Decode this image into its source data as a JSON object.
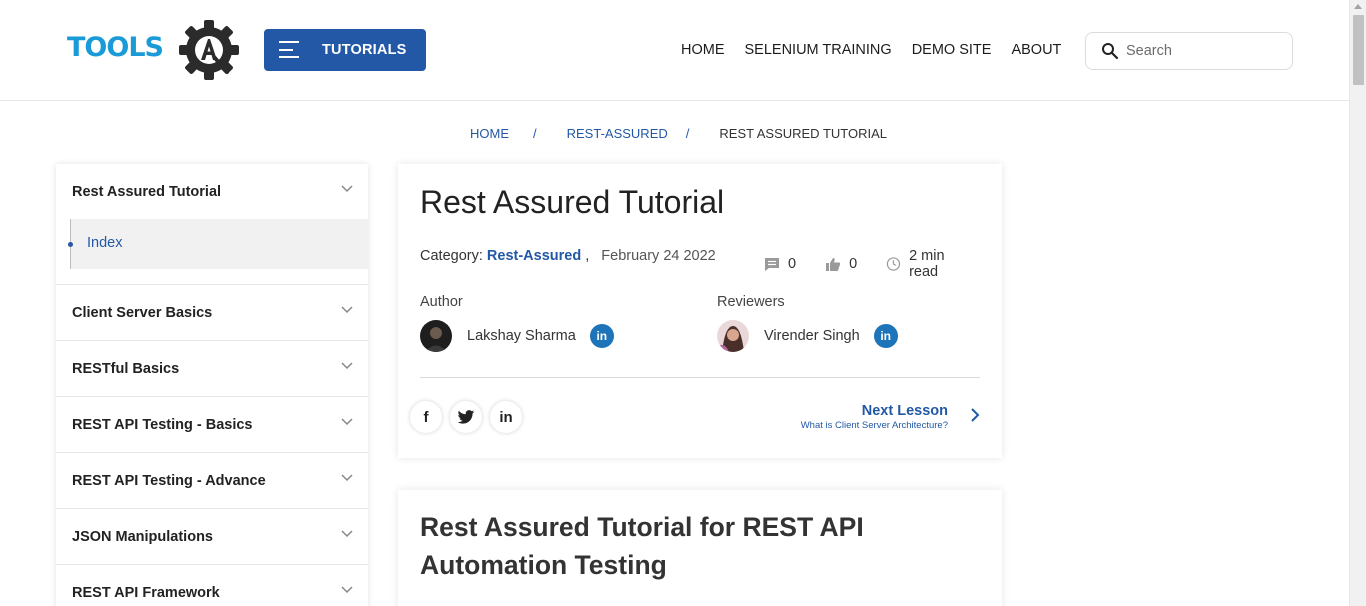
{
  "header": {
    "logo_text": "TOOLS",
    "tutorials_label": "TUTORIALS",
    "nav": [
      "HOME",
      "SELENIUM TRAINING",
      "DEMO SITE",
      "ABOUT"
    ],
    "search_placeholder": "Search"
  },
  "breadcrumb": {
    "home": "HOME",
    "category": "REST-ASSURED",
    "current": "REST ASSURED TUTORIAL",
    "separator": "/"
  },
  "sidebar": {
    "sections": [
      {
        "title": "Rest Assured Tutorial",
        "expanded": true,
        "items": [
          "Index"
        ]
      },
      {
        "title": "Client Server Basics"
      },
      {
        "title": "RESTful Basics"
      },
      {
        "title": "REST API Testing - Basics"
      },
      {
        "title": "REST API Testing - Advance"
      },
      {
        "title": "JSON Manipulations"
      },
      {
        "title": "REST API Framework"
      }
    ]
  },
  "article": {
    "title": "Rest Assured Tutorial",
    "category_prefix": "Category:",
    "category": "Rest-Assured",
    "category_suffix": ",",
    "date": "February 24 2022",
    "comments": "0",
    "likes": "0",
    "read_time": "2 min read",
    "author_label": "Author",
    "author_name": "Lakshay Sharma",
    "reviewers_label": "Reviewers",
    "reviewer_name": "Virender Singh",
    "linkedin_glyph": "in",
    "share": {
      "facebook": "f",
      "twitter": "twitter-icon",
      "linkedin": "in"
    },
    "next_label": "Next Lesson",
    "next_sub": "What is Client Server Architecture?"
  },
  "second_card": {
    "title": "Rest Assured Tutorial for REST API Automation Testing"
  },
  "colors": {
    "brand_blue": "#2358a6",
    "logo_blue": "#1a9ad6",
    "linkedin": "#1e74b8"
  }
}
